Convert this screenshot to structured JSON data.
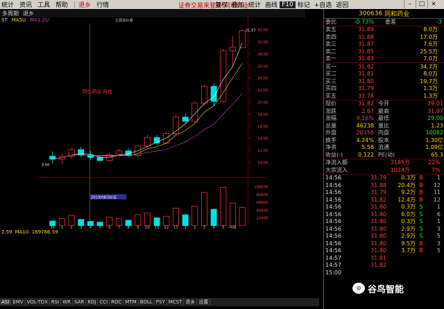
{
  "menubar": {
    "items": [
      "统计",
      "资讯",
      "工具",
      "帮助",
      "退乡",
      "行情"
    ],
    "center_text": "证券交易来登录  同和药业",
    "right_items": [
      "复权",
      "叠加",
      "统计",
      "画线",
      "F10",
      "标记",
      "+自选",
      "返回"
    ],
    "active_item": "F10"
  },
  "chart_head": {
    "period_label": "多周期",
    "tab": "退乡"
  },
  "ma_legend": {
    "items": [
      "ST",
      "MA5U",
      "MA1.2U"
    ]
  },
  "main": {
    "title": "同仁药业 月线",
    "indicator_label": "主图指标叠",
    "high_price_label": "31.97",
    "low_price_label": "9.66",
    "date_label": "2019/08/30/五",
    "y_axis_labels": [
      "32.00",
      "30.00",
      "28.00",
      "26.00",
      "24.00",
      "22.00",
      "20.00",
      "18.00",
      "16.00",
      "14.00",
      "12.00",
      "10.00"
    ],
    "vol_y_axis_labels": [
      "100000",
      "80000",
      "60000",
      "40000",
      "20000"
    ],
    "x_tick_labels": [
      "31",
      "1",
      "2",
      "3",
      "4",
      "5",
      "6",
      "7",
      "8",
      "9",
      "10",
      "11",
      "12",
      "13",
      "1",
      "2",
      "3",
      "4",
      "5",
      "月线"
    ]
  },
  "vol_legend": {
    "items": [
      "2.59",
      "MA10. 169766.59"
    ]
  },
  "bottom_tabs": [
    "ASI",
    "EMV",
    "VOL-TDX",
    "RSI",
    "WR",
    "SAR",
    "KDJ",
    "CCI",
    "ROC",
    "MTM",
    "BOLL",
    "PSY",
    "MCST",
    "退乡",
    "设置"
  ],
  "bottom_active": "ASI",
  "right_panel": {
    "stock_code": "300636",
    "stock_name": "同和药业",
    "header": {
      "left_label": "委比",
      "left_value": "-0.73%",
      "right_label": "委差",
      "right_value": "-3"
    },
    "asks": [
      {
        "label": "卖五",
        "price": "31.89",
        "vol": "8.0万"
      },
      {
        "label": "卖四",
        "price": "31.88",
        "vol": "17.0万"
      },
      {
        "label": "卖三",
        "price": "31.87",
        "vol": "7.6万"
      },
      {
        "label": "卖二",
        "price": "31.85",
        "vol": "25.5万"
      },
      {
        "label": "卖一",
        "price": "31.83",
        "vol": "7.0万"
      }
    ],
    "bids": [
      {
        "label": "买一",
        "price": "31.82",
        "vol": "34.7万"
      },
      {
        "label": "买二",
        "price": "31.81",
        "vol": "8.0万"
      },
      {
        "label": "买三",
        "price": "31.80",
        "vol": "19.7万"
      },
      {
        "label": "买四",
        "price": "31.79",
        "vol": "1.3万"
      },
      {
        "label": "买五",
        "price": "31.78",
        "vol": "1.3万"
      }
    ],
    "quote": [
      {
        "l1": "现价",
        "v1": "31.82",
        "l2": "今开",
        "v2": "29.01"
      },
      {
        "l1": "涨跌",
        "v1": "2.67",
        "l2": "最高",
        "v2": "31.97"
      },
      {
        "l1": "涨幅",
        "v1": "9.16%",
        "l2": "最低",
        "v2": "29.00"
      },
      {
        "l1": "总量",
        "v1": "46238",
        "l2": "量比",
        "v2": "1.23"
      },
      {
        "l1": "外盘",
        "v1": "20156",
        "l2": "内盘",
        "v2": "10082"
      },
      {
        "l1": "换手",
        "v1": "4.24%",
        "l2": "股本",
        "v2": "1.30亿"
      },
      {
        "l1": "净资",
        "v1": "5.58",
        "l2": "流通",
        "v2": "1.09亿"
      },
      {
        "l1": "收益(-)",
        "v1": "0.122",
        "l2": "PE(动)",
        "v2": "65.3"
      }
    ],
    "flows": [
      {
        "label": "净流入额",
        "value": "3185万",
        "pct": "22%"
      },
      {
        "label": "大宗流入",
        "value": "1024万",
        "pct": "7%"
      }
    ],
    "ticks": [
      {
        "time": "14:56",
        "price": "31.79",
        "qty": "0.3万",
        "bs": "B",
        "n": "1"
      },
      {
        "time": "14:56",
        "price": "31.88",
        "qty": "20.4万",
        "bs": "B",
        "n": "12"
      },
      {
        "time": "14:56",
        "price": "31.79",
        "qty": "9.2万",
        "bs": "B",
        "n": "11"
      },
      {
        "time": "14:56",
        "price": "31.82",
        "qty": "12.4万",
        "bs": "B",
        "n": "12"
      },
      {
        "time": "14:56",
        "price": "31.80",
        "qty": "0.3万",
        "bs": "S",
        "n": "1"
      },
      {
        "time": "14:56",
        "price": "31.80",
        "qty": "6.0万",
        "bs": "S",
        "n": "6"
      },
      {
        "time": "14:56",
        "price": "31.80",
        "qty": "0.3万",
        "bs": "S",
        "n": "1"
      },
      {
        "time": "14:56",
        "price": "31.80",
        "qty": "2.9万",
        "bs": "S",
        "n": "3"
      },
      {
        "time": "14:56",
        "price": "31.80",
        "qty": "2.9万",
        "bs": "S",
        "n": "5"
      },
      {
        "time": "14:56",
        "price": "31.80",
        "qty": "9.5万",
        "bs": "B",
        "n": "3"
      },
      {
        "time": "14:56",
        "price": "31.80",
        "qty": "3.7万",
        "bs": "B",
        "n": "5"
      },
      {
        "time": "14:57",
        "price": "31.81",
        "qty": "",
        "bs": "",
        "n": ""
      },
      {
        "time": "14:57",
        "price": "31.82",
        "qty": "",
        "bs": "",
        "n": ""
      },
      {
        "time": "15:00",
        "price": "",
        "qty": "",
        "bs": "",
        "n": ""
      }
    ]
  },
  "watermark": {
    "text": "谷鸟智能",
    "icon": "wechat-icon"
  },
  "chart_data": {
    "type": "candlestick",
    "title": "同仁药业 月线",
    "ylim": [
      8,
      33
    ],
    "candles": [
      {
        "o": 11.0,
        "h": 11.8,
        "l": 9.8,
        "c": 10.5
      },
      {
        "o": 10.5,
        "h": 11.4,
        "l": 9.66,
        "c": 11.0
      },
      {
        "o": 11.0,
        "h": 12.4,
        "l": 10.6,
        "c": 12.1
      },
      {
        "o": 12.1,
        "h": 12.6,
        "l": 10.9,
        "c": 11.2
      },
      {
        "o": 11.2,
        "h": 11.9,
        "l": 10.4,
        "c": 10.8
      },
      {
        "o": 10.8,
        "h": 11.2,
        "l": 10.0,
        "c": 10.3
      },
      {
        "o": 10.3,
        "h": 11.6,
        "l": 10.1,
        "c": 11.3
      },
      {
        "o": 11.3,
        "h": 12.2,
        "l": 11.0,
        "c": 11.9
      },
      {
        "o": 11.9,
        "h": 12.4,
        "l": 10.9,
        "c": 11.1
      },
      {
        "o": 11.1,
        "h": 12.9,
        "l": 10.8,
        "c": 12.7
      },
      {
        "o": 12.7,
        "h": 14.6,
        "l": 12.5,
        "c": 14.1
      },
      {
        "o": 14.1,
        "h": 14.5,
        "l": 12.9,
        "c": 13.2
      },
      {
        "o": 13.2,
        "h": 15.1,
        "l": 12.9,
        "c": 14.8
      },
      {
        "o": 14.8,
        "h": 17.9,
        "l": 14.5,
        "c": 17.5
      },
      {
        "o": 17.5,
        "h": 18.1,
        "l": 16.4,
        "c": 16.8
      },
      {
        "o": 16.8,
        "h": 20.2,
        "l": 16.5,
        "c": 19.8
      },
      {
        "o": 19.8,
        "h": 22.9,
        "l": 19.4,
        "c": 22.6
      },
      {
        "o": 22.6,
        "h": 23.1,
        "l": 19.4,
        "c": 20.1
      },
      {
        "o": 20.1,
        "h": 28.8,
        "l": 19.8,
        "c": 28.5
      },
      {
        "o": 28.5,
        "h": 30.9,
        "l": 25.9,
        "c": 29.1
      },
      {
        "o": 29.0,
        "h": 31.97,
        "l": 29.0,
        "c": 31.82
      }
    ],
    "volumes": [
      12000,
      18000,
      26000,
      16000,
      11000,
      9000,
      22000,
      18000,
      14000,
      28000,
      33000,
      20000,
      24000,
      45000,
      28000,
      50000,
      85000,
      42000,
      98000,
      58000,
      46238
    ],
    "vol_ylim": [
      0,
      110000
    ]
  }
}
